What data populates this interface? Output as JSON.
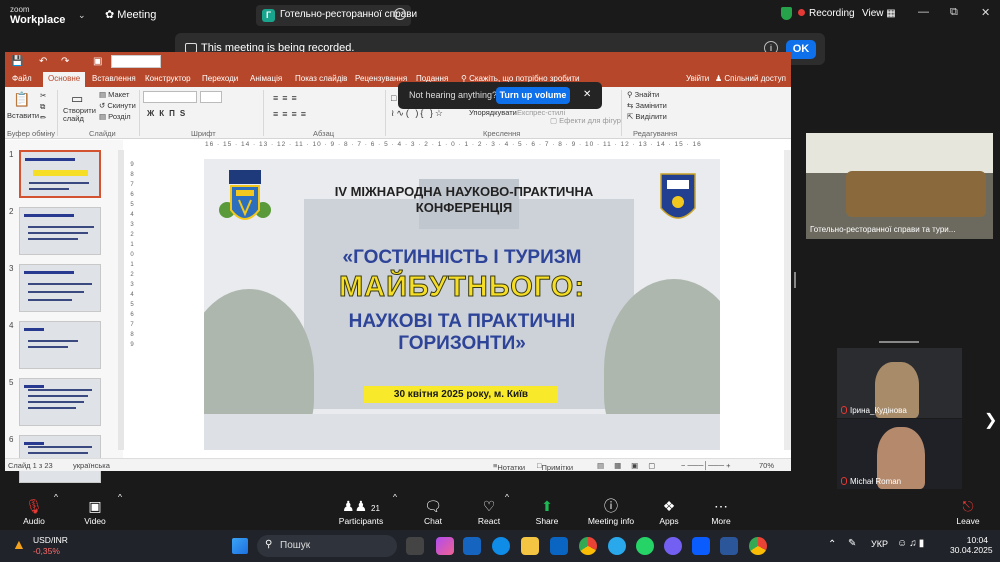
{
  "zoom": {
    "logo_top": "zoom",
    "logo_bottom": "Workplace",
    "meeting_label": "Meeting",
    "meeting_title": "Готельно-ресторанної справи",
    "recording_label": "Recording",
    "view_label": "View",
    "banner": {
      "text": "This meeting is being recorded.",
      "ok": "OK"
    },
    "toast": {
      "text": "Not hearing anything?",
      "button": "Turn up volume"
    },
    "participants_count": "21",
    "controls": [
      "Audio",
      "Video",
      "Participants",
      "Chat",
      "React",
      "Share",
      "Meeting info",
      "Apps",
      "More",
      "Leave"
    ]
  },
  "ppt": {
    "tabs": [
      "Файл",
      "Основне",
      "Вставлення",
      "Конструктор",
      "Переходи",
      "Анімація",
      "Показ слайдів",
      "Рецензування",
      "Подання",
      "Скажіть, що потрібно зробити"
    ],
    "active_tab": "Основне",
    "right_tabs": [
      "Увійти",
      "Спільний доступ"
    ],
    "ribbon": {
      "paste": "Вставити",
      "create_slide": "Створити слайд",
      "layout": "Макет",
      "reset": "Скинути",
      "section": "Розділ",
      "group_clipboard": "Буфер обміну",
      "group_slides": "Слайди",
      "group_font": "Шрифт",
      "group_paragraph": "Абзац",
      "group_drawing": "Креслення",
      "group_editing": "Редагування",
      "arrange": "Упорядкувати",
      "express_styles": "Експрес-стилі",
      "shape_effects": "Ефекти для фігур",
      "find": "Знайти",
      "replace": "Замінити",
      "select": "Виділити"
    },
    "ruler_h": "16 · 15 · 14 · 13 · 12 · 11 · 10 · 9 · 8 · 7 · 6 · 5 · 4 · 3 · 2 · 1 · 0 · 1 · 2 · 3 · 4 · 5 · 6 · 7 · 8 · 9 · 10 · 11 · 12 · 13 · 14 · 15 · 16",
    "thumb_numbers": [
      "1",
      "2",
      "3",
      "4",
      "5",
      "6"
    ],
    "status": {
      "slide": "Слайд 1 з 23",
      "lang": "українська",
      "notes": "Нотатки",
      "comments": "Примітки",
      "zoom": "70%"
    },
    "slide": {
      "conf_line1": "IV МІЖНАРОДНА НАУКОВО-ПРАКТИЧНА",
      "conf_line2": "КОНФЕРЕНЦІЯ",
      "title1": "«ГОСТИННІСТЬ І ТУРИЗМ",
      "title2": "МАЙБУТНЬОГО:",
      "title3a": "НАУКОВІ ТА ПРАКТИЧНІ",
      "title3b": "ГОРИЗОНТИ»",
      "date": "30 квітня 2025 року, м. Київ"
    }
  },
  "videos": {
    "room_label": "Готельно-ресторанної справи та тури...",
    "p1": "Ірина_Кудінова",
    "p2": "Michał Roman"
  },
  "taskbar": {
    "ticker": "USD/INR",
    "ticker_change": "-0,35%",
    "search_placeholder": "Пошук",
    "lang": "УКР",
    "time": "10:04",
    "date": "30.04.2025"
  },
  "colors": {
    "accent": "#0e71eb",
    "ppt": "#b7472a",
    "recording": "#e53935",
    "title_blue": "#2e4499",
    "title_yellow": "#f6de26"
  }
}
